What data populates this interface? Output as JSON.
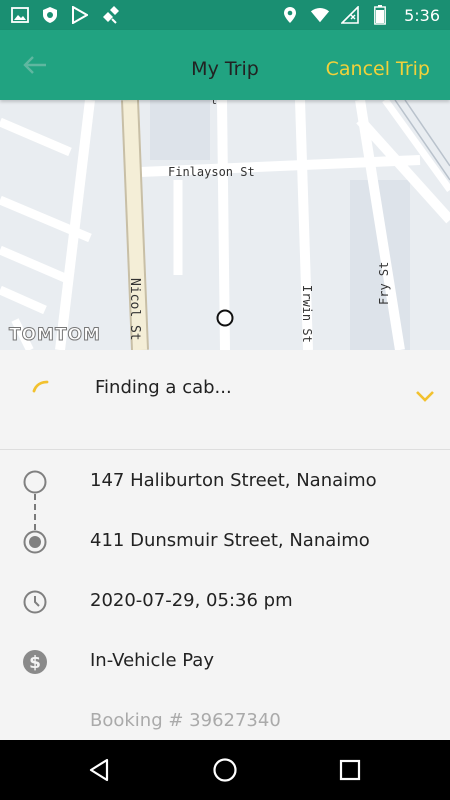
{
  "status_bar": {
    "time": "5:36",
    "left_icons": [
      "gallery-icon",
      "shield-icon",
      "play-store-icon",
      "satellite-icon"
    ],
    "right_icons": [
      "location-icon",
      "wifi-icon",
      "signal-icon",
      "battery-icon"
    ]
  },
  "app_bar": {
    "title": "My Trip",
    "cancel_label": "Cancel Trip",
    "back_icon": "arrow-left-icon"
  },
  "map": {
    "streets": [
      "Finlayson St",
      "Fry St",
      "Irwin St",
      "Nicol St"
    ],
    "brand": "TOMTOM"
  },
  "status": {
    "text": "Finding a cab..."
  },
  "trip": {
    "pickup": "147 Haliburton Street, Nanaimo",
    "dropoff": "411 Dunsmuir Street, Nanaimo",
    "datetime": "2020-07-29, 05:36 pm",
    "payment": "In-Vehicle Pay",
    "booking": "Booking # 39627340"
  },
  "nav_bar": {
    "icons": [
      "back-triangle-icon",
      "home-circle-icon",
      "recents-square-icon"
    ]
  },
  "colors": {
    "status_bar": "#1a8f72",
    "app_bar": "#21a381",
    "accent_yellow": "#f2d13a",
    "background": "#f4f4f4"
  }
}
